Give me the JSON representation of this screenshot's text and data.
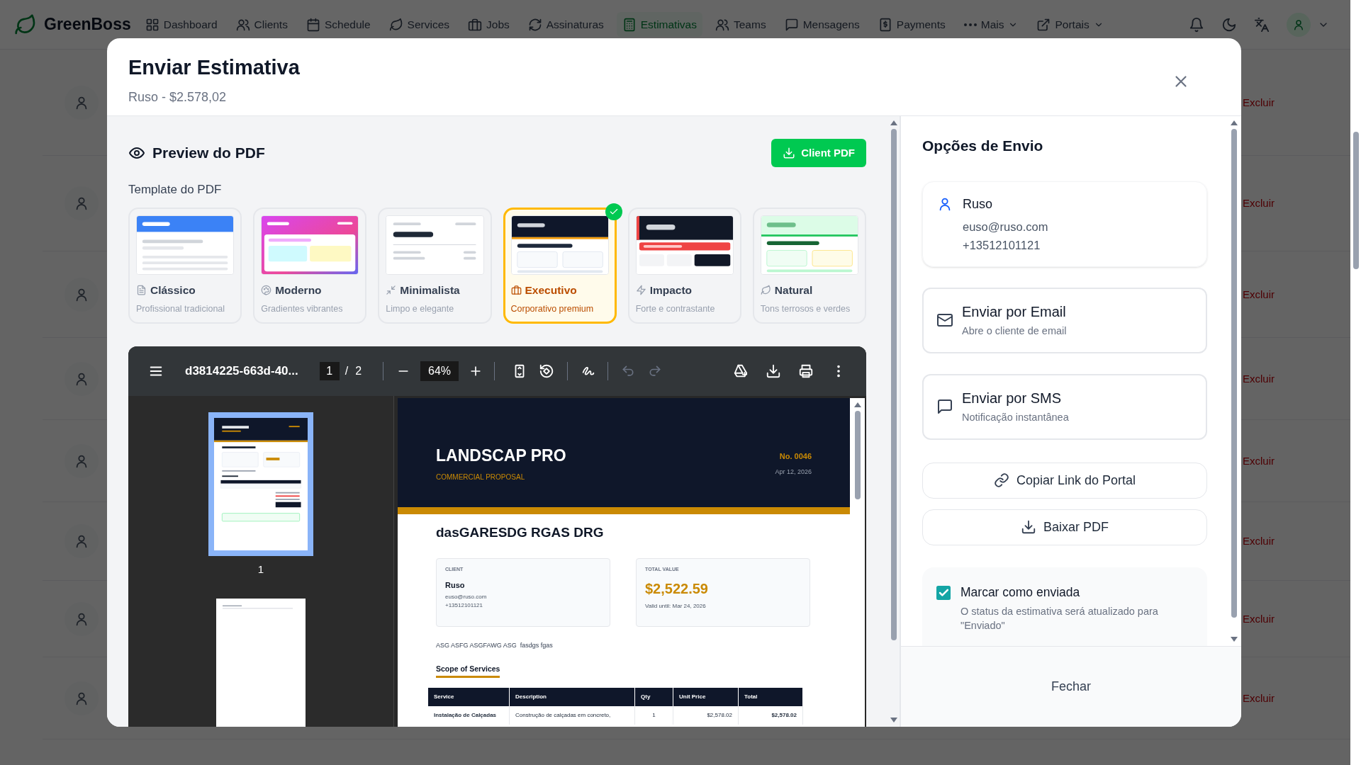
{
  "nav": {
    "brand": "GreenBoss",
    "items": [
      {
        "label": "Dashboard",
        "kind": "link",
        "selected": false
      },
      {
        "label": "Clients",
        "kind": "link",
        "selected": false
      },
      {
        "label": "Schedule",
        "kind": "link",
        "selected": false
      },
      {
        "label": "Services",
        "kind": "link",
        "selected": false
      },
      {
        "label": "Jobs",
        "kind": "link",
        "selected": false
      },
      {
        "label": "Assinaturas",
        "kind": "link",
        "selected": false
      },
      {
        "label": "Estimativas",
        "kind": "link",
        "selected": true
      },
      {
        "label": "Teams",
        "kind": "link",
        "selected": false
      },
      {
        "label": "Mensagens",
        "kind": "link",
        "selected": false
      },
      {
        "label": "Payments",
        "kind": "link",
        "selected": false
      },
      {
        "label": "Mais",
        "kind": "menu",
        "selected": false
      },
      {
        "label": "Portais",
        "kind": "menu",
        "selected": false
      }
    ]
  },
  "background_rows": [
    {
      "action": "Excluir"
    },
    {
      "action": "Excluir"
    },
    {
      "action": "Excluir"
    },
    {
      "action": "Excluir"
    },
    {
      "action": "Excluir"
    },
    {
      "action": "Excluir"
    },
    {
      "action": "Excluir"
    },
    {
      "action": "Excluir"
    }
  ],
  "dialog": {
    "title": "Enviar Estimativa",
    "subtitle": "Ruso - $2.578,02",
    "preview_heading": "Preview do PDF",
    "client_pdf_button": "Client PDF",
    "template_label": "Template do PDF",
    "templates": [
      {
        "kind": "classic",
        "name": "Clássico",
        "description": "Profissional tradicional",
        "selected": false
      },
      {
        "kind": "modern",
        "name": "Moderno",
        "description": "Gradientes vibrantes",
        "selected": false
      },
      {
        "kind": "minimal",
        "name": "Minimalista",
        "description": "Limpo e elegante",
        "selected": false
      },
      {
        "kind": "executive",
        "name": "Executivo",
        "description": "Corporativo premium",
        "selected": true
      },
      {
        "kind": "impact",
        "name": "Impacto",
        "description": "Forte e contrastante",
        "selected": false
      },
      {
        "kind": "natural",
        "name": "Natural",
        "description": "Tons terrosos e verdes",
        "selected": false
      }
    ],
    "viewer": {
      "filename": "d3814225-663d-40...",
      "page": "1",
      "page_separator": "/",
      "page_count": "2",
      "zoom": "64%",
      "history_buttons": [
        {
          "disabled": true
        },
        {
          "disabled": true
        }
      ],
      "thumbnails": [
        {
          "label": "1",
          "selected": true
        },
        {
          "selected": false
        }
      ],
      "document": {
        "company": "LANDSCAP PRO",
        "doc_type": "COMMERCIAL PROPOSAL",
        "number": "No. 0046",
        "date": "Apr 12, 2026",
        "title": "dasGARESDG RGAS DRG",
        "client_label": "CLIENT",
        "client_name": "Ruso",
        "client_email": "euso@ruso.com",
        "client_phone": "+13512101121",
        "total_label": "TOTAL VALUE",
        "total": "$2,522.59",
        "valid_until": "Valid until: Mar 24, 2026",
        "note": "ASG ASFG ASGFAWG ASG  fasdgs fgas",
        "section": "Scope of Services",
        "columns": [
          "Service",
          "Description",
          "Qty",
          "Unit Price",
          "Total"
        ],
        "rows": [
          [
            "Instalação de Calçadas",
            "Construção de calçadas em concreto,",
            "1",
            "$2,578.02",
            "$2,578.02"
          ]
        ]
      }
    },
    "send": {
      "heading": "Opções de Envio",
      "recipient": {
        "name": "Ruso",
        "email": "euso@ruso.com",
        "phone": "+13512101121"
      },
      "channels": [
        {
          "title": "Enviar por Email",
          "description": "Abre o cliente de email"
        },
        {
          "title": "Enviar por SMS",
          "description": "Notificação instantânea"
        }
      ],
      "actions": [
        "Copiar Link do Portal",
        "Baixar PDF"
      ],
      "mark_sent": {
        "label": "Marcar como enviada",
        "description": "O status da estimativa será atualizado para \"Enviado\"",
        "checked": true
      }
    },
    "close_button": "Fechar"
  }
}
